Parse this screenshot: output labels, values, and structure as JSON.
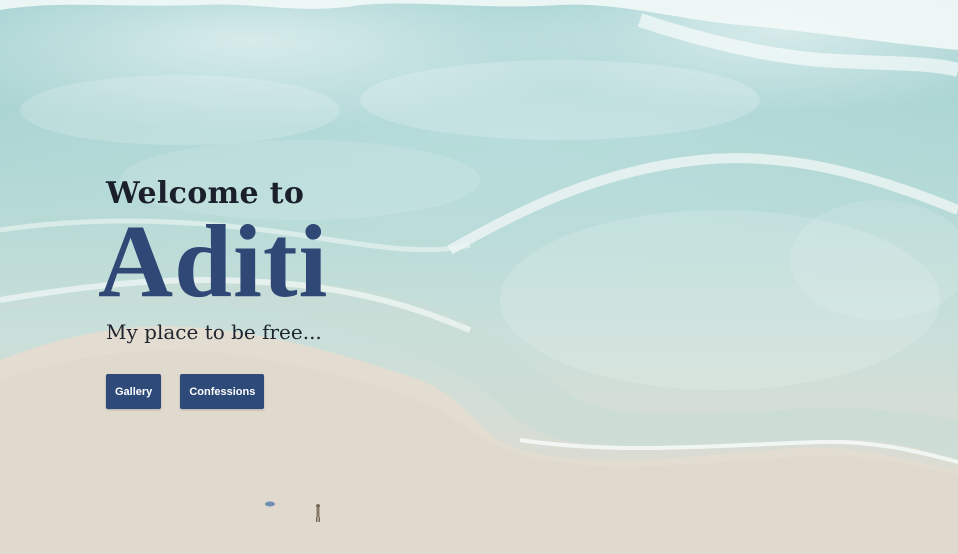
{
  "hero": {
    "welcome": "Welcome to",
    "name": "Aditi",
    "tagline": "My place to be free...",
    "buttons": [
      {
        "label": "Gallery"
      },
      {
        "label": "Confessions"
      }
    ]
  },
  "colors": {
    "accent": "#2e4a78",
    "heading": "#2f4876"
  }
}
